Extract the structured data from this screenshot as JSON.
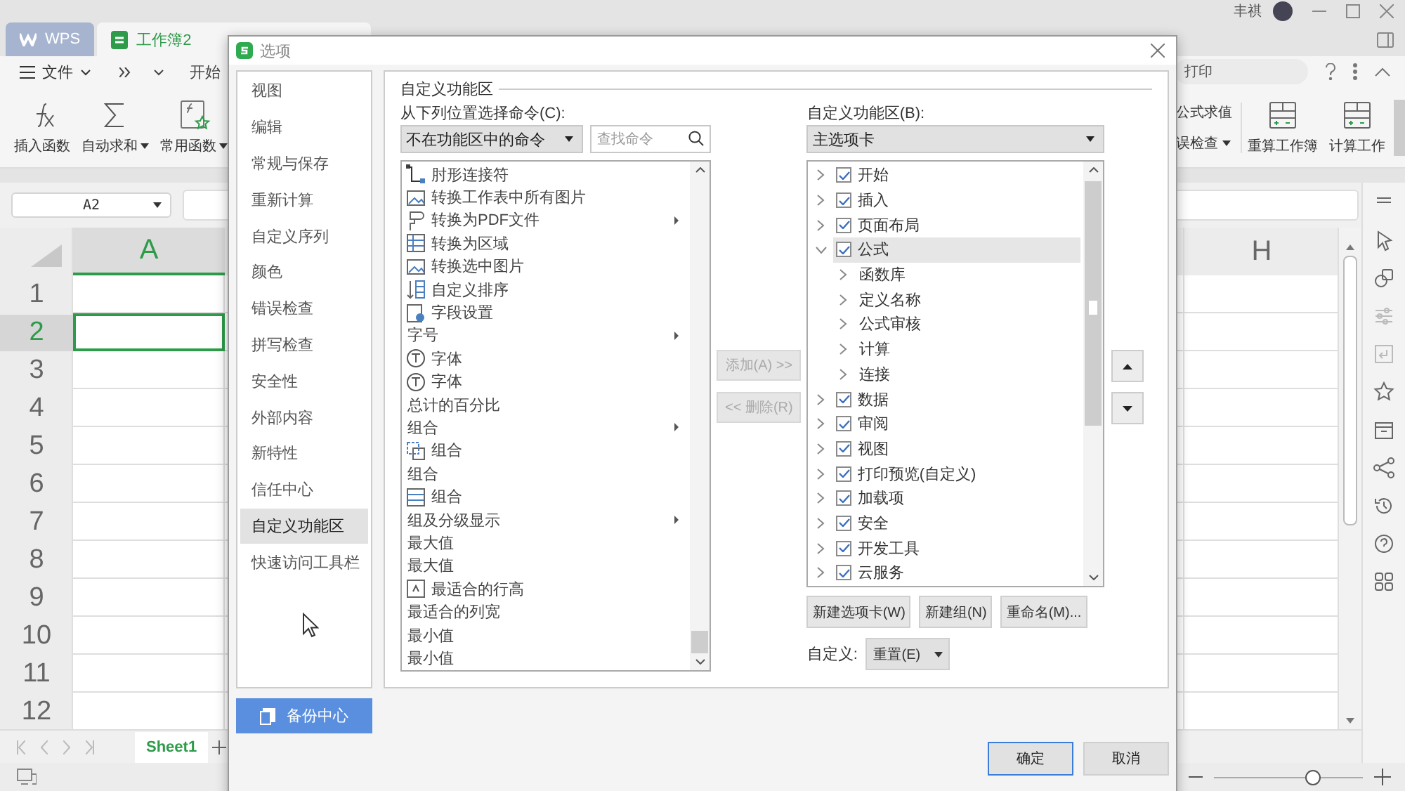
{
  "app": {
    "tabs": [
      {
        "label": "WPS",
        "kind": "home",
        "selected": false
      },
      {
        "label": "工作簿2",
        "kind": "document",
        "selected": true
      }
    ],
    "user": "丰祺",
    "file_menu": "文件",
    "menu_tabs": [
      "开始"
    ],
    "search_placeholder": "打印",
    "toolbar_left": [
      {
        "label": "插入函数",
        "dropdown": false
      },
      {
        "label": "自动求和",
        "dropdown": true
      },
      {
        "label": "常用函数",
        "dropdown": true
      }
    ],
    "toolbar_small": [
      {
        "label": "公式求值",
        "dropdown": false
      },
      {
        "label": "误检查",
        "dropdown": true
      }
    ],
    "toolbar_large": [
      "重算工作簿",
      "计算工作"
    ],
    "name_box": "A2",
    "columns": [
      {
        "label": "A",
        "selected": true
      },
      {
        "label": "H",
        "selected": false
      }
    ],
    "rows": [
      {
        "label": "1",
        "selected": false
      },
      {
        "label": "2",
        "selected": true
      },
      {
        "label": "3",
        "selected": false
      },
      {
        "label": "4",
        "selected": false
      },
      {
        "label": "5",
        "selected": false
      },
      {
        "label": "6",
        "selected": false
      },
      {
        "label": "7",
        "selected": false
      },
      {
        "label": "8",
        "selected": false
      },
      {
        "label": "9",
        "selected": false
      },
      {
        "label": "10",
        "selected": false
      },
      {
        "label": "11",
        "selected": false
      },
      {
        "label": "12",
        "selected": false
      }
    ],
    "sheets": [
      {
        "label": "Sheet1",
        "selected": true
      }
    ],
    "zoom": {
      "level": 0.67
    }
  },
  "dialog": {
    "title": "选项",
    "nav": [
      {
        "label": "视图",
        "selected": false
      },
      {
        "label": "编辑",
        "selected": false
      },
      {
        "label": "常规与保存",
        "selected": false
      },
      {
        "label": "重新计算",
        "selected": false
      },
      {
        "label": "自定义序列",
        "selected": false
      },
      {
        "label": "颜色",
        "selected": false
      },
      {
        "label": "错误检查",
        "selected": false
      },
      {
        "label": "拼写检查",
        "selected": false
      },
      {
        "label": "安全性",
        "selected": false
      },
      {
        "label": "外部内容",
        "selected": false
      },
      {
        "label": "新特性",
        "selected": false
      },
      {
        "label": "信任中心",
        "selected": false
      },
      {
        "label": "自定义功能区",
        "selected": true
      },
      {
        "label": "快速访问工具栏",
        "selected": false
      }
    ],
    "backup": "备份中心",
    "section": "自定义功能区",
    "commands_label": "从下列位置选择命令(C):",
    "commands_source": "不在功能区中的命令",
    "search_placeholder": "查找命令",
    "commands": [
      {
        "label": "肘形连接符",
        "kind": "icon",
        "submenu": false
      },
      {
        "label": "转换工作表中所有图片",
        "kind": "icon",
        "submenu": false
      },
      {
        "label": "转换为PDF文件",
        "kind": "icon",
        "submenu": true
      },
      {
        "label": "转换为区域",
        "kind": "icon",
        "submenu": false
      },
      {
        "label": "转换选中图片",
        "kind": "icon",
        "submenu": false
      },
      {
        "label": "自定义排序",
        "kind": "icon",
        "submenu": false
      },
      {
        "label": "字段设置",
        "kind": "icon",
        "submenu": false
      },
      {
        "label": "字号",
        "kind": "plain",
        "submenu": true
      },
      {
        "label": "字体",
        "kind": "icon",
        "submenu": false
      },
      {
        "label": "字体",
        "kind": "icon",
        "submenu": false
      },
      {
        "label": "总计的百分比",
        "kind": "plain",
        "submenu": false
      },
      {
        "label": "组合",
        "kind": "plain",
        "submenu": true
      },
      {
        "label": "组合",
        "kind": "icon",
        "submenu": false
      },
      {
        "label": "组合",
        "kind": "plain",
        "submenu": false
      },
      {
        "label": "组合",
        "kind": "icon",
        "submenu": false
      },
      {
        "label": "组及分级显示",
        "kind": "plain",
        "submenu": true
      },
      {
        "label": "最大值",
        "kind": "plain",
        "submenu": false
      },
      {
        "label": "最大值",
        "kind": "plain",
        "submenu": false
      },
      {
        "label": "最适合的行高",
        "kind": "icon",
        "submenu": false
      },
      {
        "label": "最适合的列宽",
        "kind": "plain",
        "submenu": false
      },
      {
        "label": "最小值",
        "kind": "plain",
        "submenu": false
      },
      {
        "label": "最小值",
        "kind": "plain",
        "submenu": false
      }
    ],
    "add": {
      "label": "添加(A) >>",
      "disabled": true
    },
    "remove": {
      "label": "<< 删除(R)",
      "disabled": true
    },
    "ribbon_label": "自定义功能区(B):",
    "ribbon_source": "主选项卡",
    "ribbon": [
      {
        "label": "开始",
        "kind": "tab",
        "checked": true,
        "expanded": false,
        "selected": false
      },
      {
        "label": "插入",
        "kind": "tab",
        "checked": true,
        "expanded": false,
        "selected": false
      },
      {
        "label": "页面布局",
        "kind": "tab",
        "checked": true,
        "expanded": false,
        "selected": false
      },
      {
        "label": "公式",
        "kind": "tab",
        "checked": true,
        "expanded": true,
        "selected": true,
        "children": [
          {
            "label": "函数库",
            "kind": "group",
            "expanded": false,
            "selected": false
          },
          {
            "label": "定义名称",
            "kind": "group",
            "expanded": false,
            "selected": false
          },
          {
            "label": "公式审核",
            "kind": "group",
            "expanded": false,
            "selected": false
          },
          {
            "label": "计算",
            "kind": "group",
            "expanded": false,
            "selected": false
          },
          {
            "label": "连接",
            "kind": "group",
            "expanded": false,
            "selected": false
          }
        ]
      },
      {
        "label": "数据",
        "kind": "tab",
        "checked": true,
        "expanded": false,
        "selected": false
      },
      {
        "label": "审阅",
        "kind": "tab",
        "checked": true,
        "expanded": false,
        "selected": false
      },
      {
        "label": "视图",
        "kind": "tab",
        "checked": true,
        "expanded": false,
        "selected": false
      },
      {
        "label": "打印预览(自定义)",
        "kind": "tab",
        "checked": true,
        "expanded": false,
        "selected": false
      },
      {
        "label": "加载项",
        "kind": "tab",
        "checked": true,
        "expanded": false,
        "selected": false
      },
      {
        "label": "安全",
        "kind": "tab",
        "checked": true,
        "expanded": false,
        "selected": false
      },
      {
        "label": "开发工具",
        "kind": "tab",
        "checked": true,
        "expanded": false,
        "selected": false
      },
      {
        "label": "云服务",
        "kind": "tab",
        "checked": true,
        "expanded": false,
        "selected": false
      }
    ],
    "ribbon_buttons": [
      "新建选项卡(W)",
      "新建组(N)",
      "重命名(M)..."
    ],
    "custom_label": "自定义:",
    "reset": "重置(E)",
    "footer": [
      {
        "label": "确定",
        "default": true
      },
      {
        "label": "取消",
        "default": false
      }
    ]
  }
}
